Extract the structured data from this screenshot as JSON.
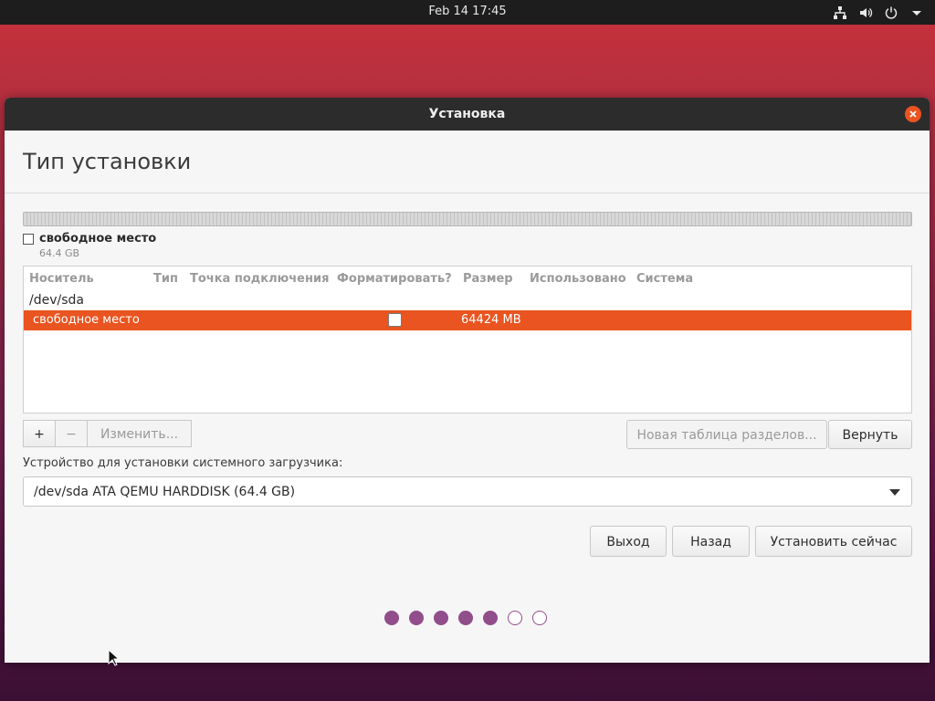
{
  "topbar": {
    "clock": "Feb 14  17:45",
    "icons": [
      "network-icon",
      "volume-icon",
      "power-icon",
      "menu-arrow-icon"
    ]
  },
  "window": {
    "title": "Установка",
    "heading": "Тип установки"
  },
  "partition_bar": {
    "legend_label": "свободное место",
    "legend_size": "64.4 GB"
  },
  "table": {
    "headers": [
      "Носитель",
      "Тип",
      "Точка подключения",
      "Форматировать?",
      "Размер",
      "Использовано",
      "Система"
    ],
    "device": "/dev/sda",
    "rows": [
      {
        "name": "свободное место",
        "type": "",
        "mount": "",
        "format": false,
        "size": "64424 MB",
        "used": "",
        "system": "",
        "selected": true
      }
    ]
  },
  "buttons": {
    "add": "+",
    "remove": "−",
    "change": "Изменить...",
    "new_table": "Новая таблица разделов...",
    "revert": "Вернуть",
    "quit": "Выход",
    "back": "Назад",
    "install_now": "Установить сейчас"
  },
  "bootloader": {
    "label": "Устройство для установки системного загрузчика:",
    "selected": "/dev/sda ATA QEMU HARDDISK (64.4 GB)"
  },
  "progress": {
    "total_steps": 7,
    "completed_steps": 5
  },
  "colors": {
    "accent": "#e95420",
    "progress": "#924d8b",
    "titlebar": "#2c2c2c"
  }
}
